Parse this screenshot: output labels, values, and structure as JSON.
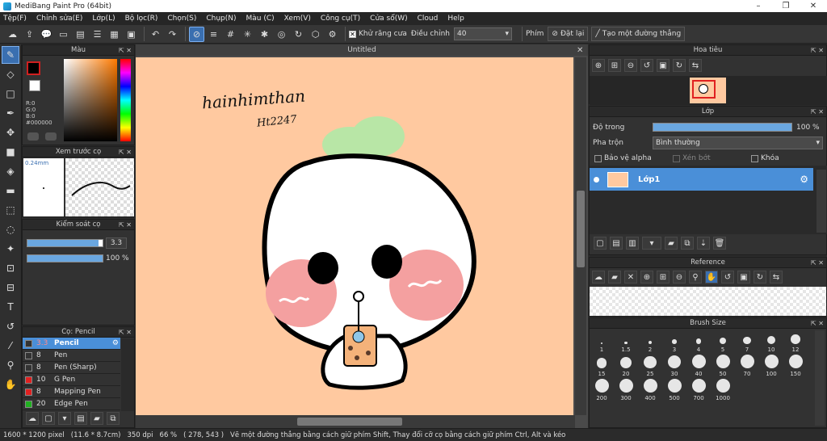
{
  "app": {
    "title": "MediBang Paint Pro (64bit)"
  },
  "window_controls": [
    "–",
    "❐",
    "✕"
  ],
  "menu": [
    "Tệp(F)",
    "Chỉnh sửa(E)",
    "Lớp(L)",
    "Bộ lọc(R)",
    "Chọn(S)",
    "Chụp(N)",
    "Màu (C)",
    "Xem(V)",
    "Công cụ(T)",
    "Cửa sổ(W)",
    "Cloud",
    "Help"
  ],
  "toolbar": {
    "antialias_label": "Khử răng cưa",
    "adjust_label": "Điều chỉnh",
    "adjust_value": "40",
    "phim_label": "Phím",
    "reset_label": "Đặt lại",
    "create_line_label": "Tạo một đường thẳng"
  },
  "color_panel": {
    "title": "Màu",
    "r": "R:0",
    "g": "G:0",
    "b": "B:0",
    "hex": "#000000",
    "primary_color": "#000000",
    "secondary_color": "#ffffff"
  },
  "preview_panel": {
    "title": "Xem trước cọ",
    "size": "0.24mm"
  },
  "brush_control": {
    "title": "Kiểm soát cọ",
    "size_value": "3.3",
    "opacity_value": "100 %",
    "size_fraction": 0.95,
    "opacity_fraction": 1.0
  },
  "brush_list": {
    "title": "Cọ: Pencil",
    "items": [
      {
        "size": "3.3",
        "name": "Pencil",
        "color": "#333333",
        "active": true
      },
      {
        "size": "8",
        "name": "Pen",
        "color": "#333333",
        "active": false
      },
      {
        "size": "8",
        "name": "Pen (Sharp)",
        "color": "#333333",
        "active": false
      },
      {
        "size": "10",
        "name": "G Pen",
        "color": "#e02020",
        "active": false
      },
      {
        "size": "8",
        "name": "Mapping Pen",
        "color": "#e02020",
        "active": false
      },
      {
        "size": "20",
        "name": "Edge Pen",
        "color": "#20b020",
        "active": false
      }
    ]
  },
  "canvas": {
    "tab": "Untitled",
    "text1": "hainhimthan",
    "text2": "Ht2247",
    "background": "#ffc9a0"
  },
  "navigator": {
    "title": "Hoa tiêu"
  },
  "layer_panel": {
    "title": "Lớp",
    "opacity_label": "Độ trong",
    "opacity_value": "100 %",
    "opacity_fraction": 1.0,
    "blend_label": "Pha trộn",
    "blend_value": "Bình thường",
    "protect_alpha": "Bảo vệ alpha",
    "clipping": "Xén bớt",
    "lock": "Khóa",
    "layer_name": "Lớp1"
  },
  "reference": {
    "title": "Reference"
  },
  "brush_size": {
    "title": "Brush Size",
    "sizes": [
      "1",
      "1.5",
      "2",
      "3",
      "4",
      "5",
      "7",
      "10",
      "12",
      "15",
      "20",
      "25",
      "30",
      "40",
      "50",
      "70",
      "100",
      "150",
      "200",
      "300",
      "400",
      "500",
      "700",
      "1000"
    ]
  },
  "status": {
    "dims": "1600 * 1200 pixel",
    "cm": "(11.6 * 8.7cm)",
    "dpi": "350 dpi",
    "zoom": "66 %",
    "coords": "( 278, 543 )",
    "hint": "Vẽ một đường thẳng bằng cách giữ phím Shift, Thay đổi cỡ cọ bằng cách giữ phím Ctrl, Alt và kéo"
  }
}
